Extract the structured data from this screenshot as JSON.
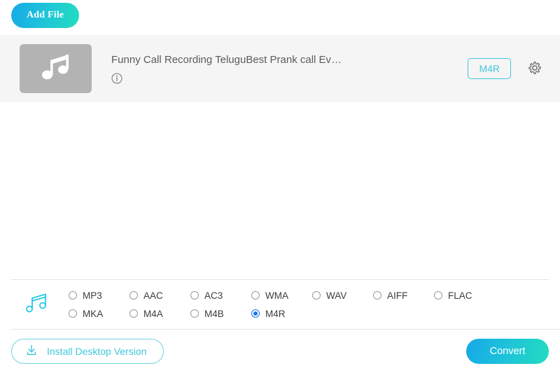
{
  "toolbar": {
    "add_file_label": "Add File"
  },
  "file_list": {
    "items": [
      {
        "thumbnail_icon": "music-note-icon",
        "title": "Funny Call Recording TeluguBest Prank call Ev…",
        "info_icon": "info-icon",
        "format_badge": "M4R",
        "settings_icon": "gear-icon"
      }
    ]
  },
  "formats": {
    "icon": "music-note-icon",
    "options": [
      {
        "label": "MP3",
        "selected": false
      },
      {
        "label": "AAC",
        "selected": false
      },
      {
        "label": "AC3",
        "selected": false
      },
      {
        "label": "WMA",
        "selected": false
      },
      {
        "label": "WAV",
        "selected": false
      },
      {
        "label": "AIFF",
        "selected": false
      },
      {
        "label": "FLAC",
        "selected": false
      },
      {
        "label": "MKA",
        "selected": false
      },
      {
        "label": "M4A",
        "selected": false
      },
      {
        "label": "M4B",
        "selected": false
      },
      {
        "label": "M4R",
        "selected": true
      },
      {
        "label": "",
        "selected": false
      },
      {
        "label": "",
        "selected": false
      },
      {
        "label": "",
        "selected": false
      }
    ],
    "selected": "M4R"
  },
  "footer": {
    "install_label": "Install Desktop Version",
    "install_icon": "download-icon",
    "convert_label": "Convert"
  },
  "colors": {
    "accent_cyan": "#3fc6dd",
    "gradient_start": "#17a9e8",
    "gradient_end": "#22dcc0",
    "radio_selected": "#1a73e8",
    "row_background": "#f5f5f5",
    "thumb_background": "#b3b3b3"
  }
}
